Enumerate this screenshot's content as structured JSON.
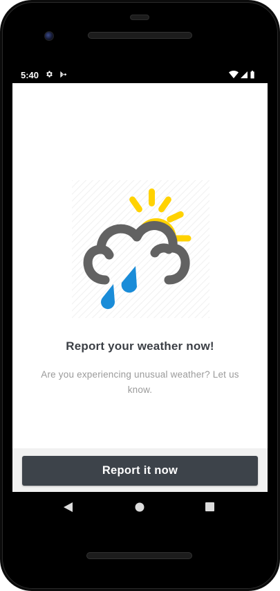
{
  "status_bar": {
    "time": "5:40",
    "icons": [
      "gear-icon",
      "play-store-icon",
      "wifi-icon",
      "signal-icon",
      "battery-icon"
    ]
  },
  "main": {
    "illustration_icon": "rain-cloud-sun-icon",
    "title": "Report your weather now!",
    "subtitle": "Are you experiencing unusual weather? Let us know."
  },
  "action": {
    "button_label": "Report it now"
  },
  "nav_bar": {
    "icons": [
      "back-icon",
      "home-icon",
      "recents-icon"
    ]
  },
  "colors": {
    "button_bg": "#3d434a",
    "sun_yellow": "#ffd200",
    "cloud_gray": "#5f5f5f",
    "rain_blue": "#1a8cd8",
    "title_text": "#3b3f45",
    "subtitle_text": "#9a9a9a"
  }
}
